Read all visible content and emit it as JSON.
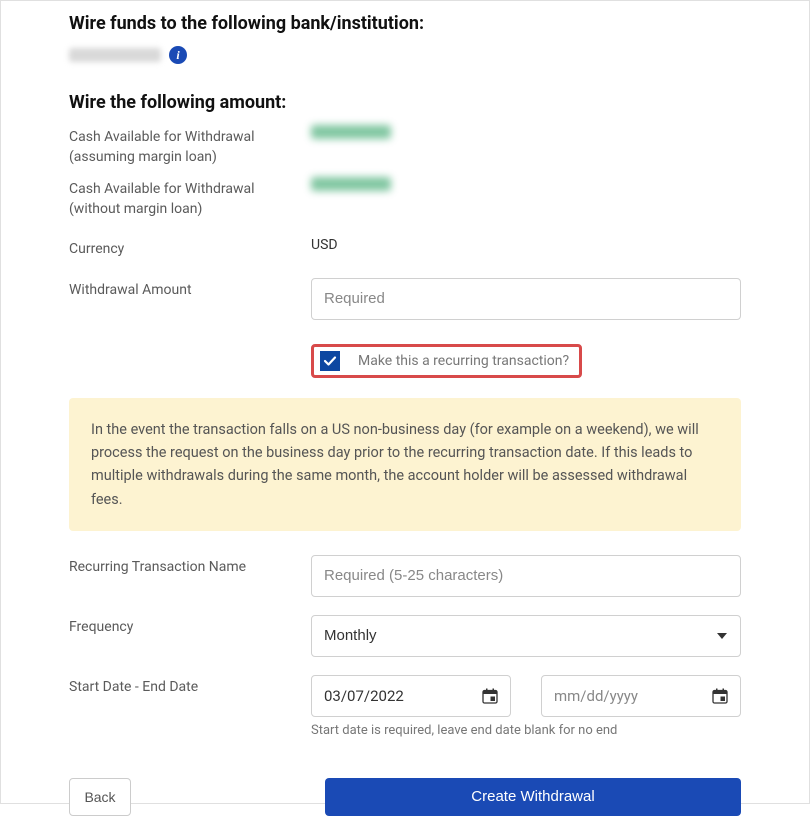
{
  "headings": {
    "bank": "Wire funds to the following bank/institution:",
    "amount": "Wire the following amount:"
  },
  "labels": {
    "cash_margin": "Cash Available for Withdrawal\n(assuming margin loan)",
    "cash_no_margin": "Cash Available for Withdrawal\n(without margin loan)",
    "currency": "Currency",
    "withdrawal_amount": "Withdrawal Amount",
    "recurring_name": "Recurring Transaction Name",
    "frequency": "Frequency",
    "date_range": "Start Date - End Date"
  },
  "values": {
    "currency": "USD",
    "frequency_selected": "Monthly",
    "start_date": "03/07/2022",
    "end_date_placeholder": "mm/dd/yyyy"
  },
  "placeholders": {
    "amount": "Required",
    "recurring_name": "Required (5-25 characters)"
  },
  "checkbox": {
    "label": "Make this a recurring transaction?",
    "checked": true
  },
  "notice": "In the event the transaction falls on a US non-business day (for example on a weekend), we will process the request on the business day prior to the recurring transaction date. If this leads to multiple withdrawals during the same month, the account holder will be assessed withdrawal fees.",
  "hint": "Start date is required, leave end date blank for no end",
  "buttons": {
    "back": "Back",
    "create": "Create Withdrawal"
  }
}
